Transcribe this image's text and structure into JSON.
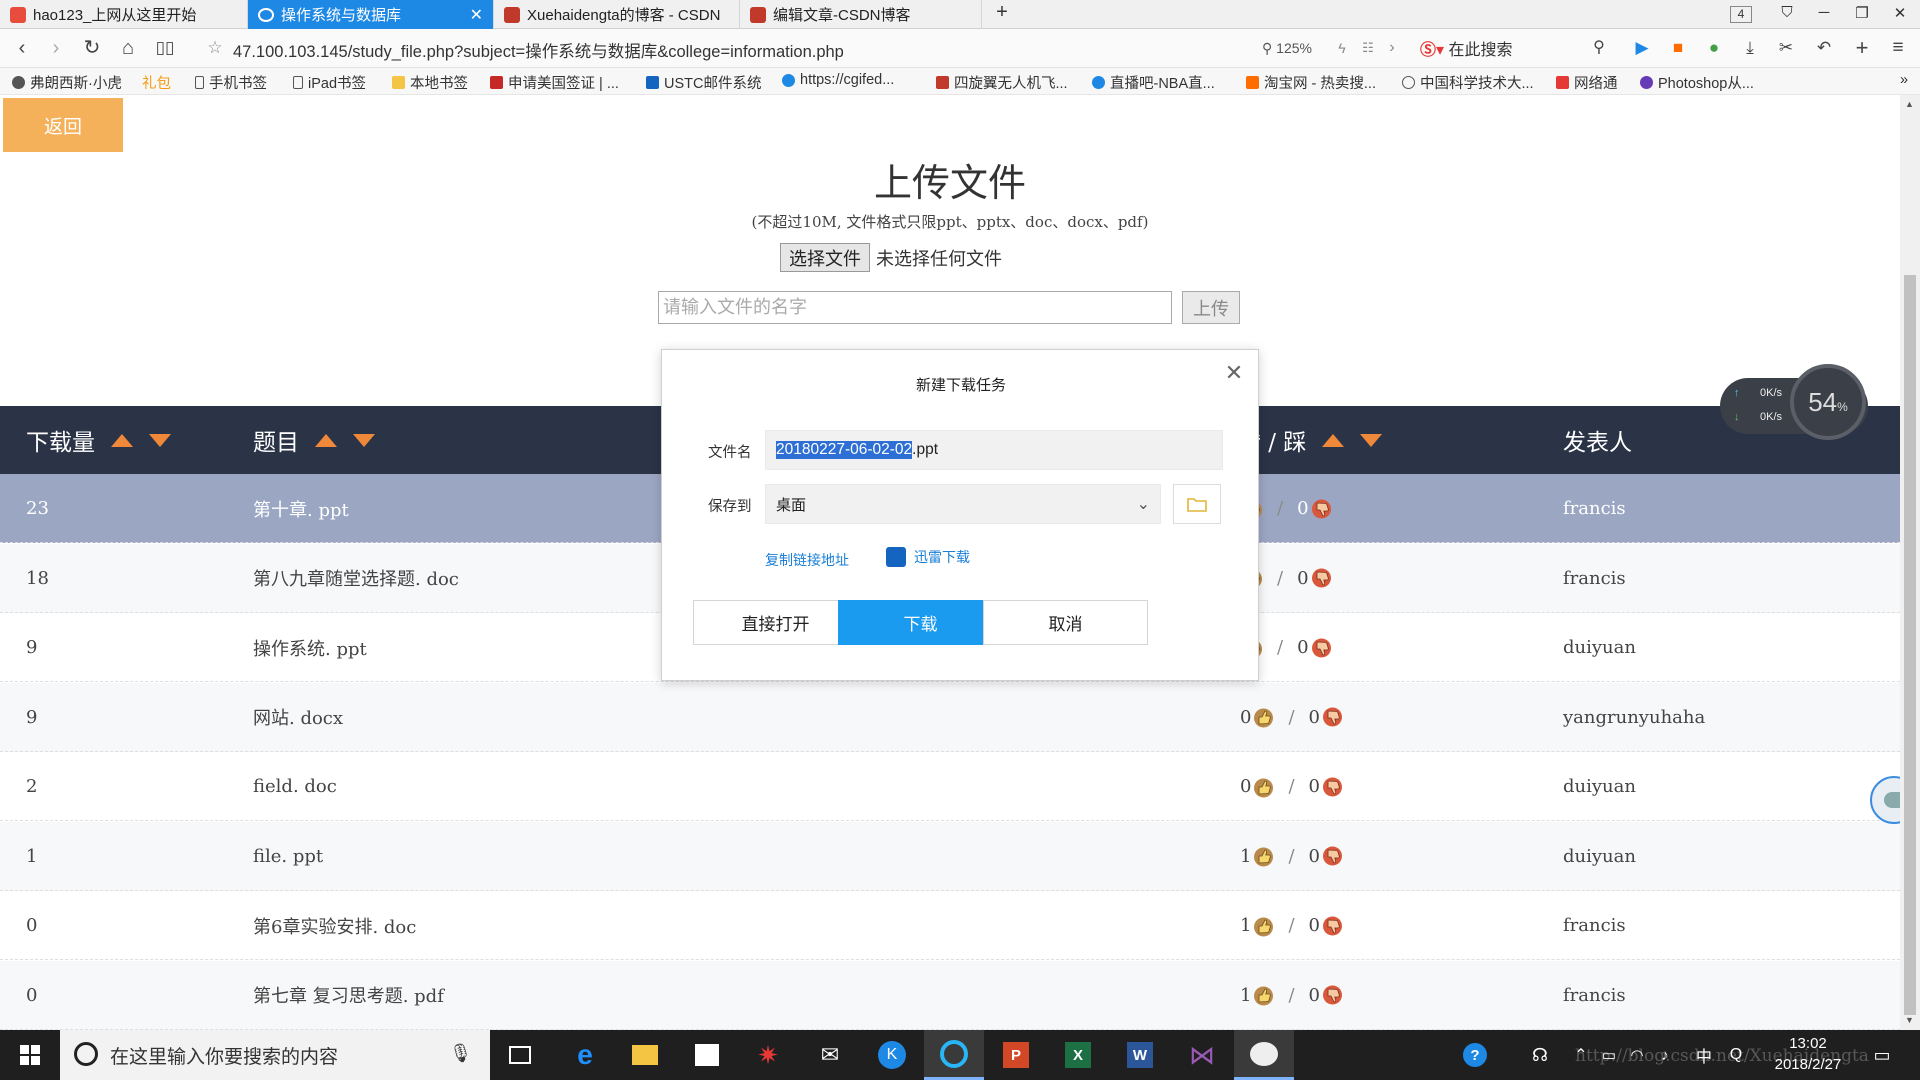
{
  "browser": {
    "tabs": [
      {
        "label": "hao123_上网从这里开始",
        "active": false,
        "icon_color": "#e74c3c"
      },
      {
        "label": "操作系统与数据库",
        "active": true,
        "icon_color": "#ffffff"
      },
      {
        "label": "Xuehaidengta的博客 - CSDN",
        "active": false,
        "icon_color": "#c0392b"
      },
      {
        "label": "编辑文章-CSDN博客",
        "active": false,
        "icon_color": "#c0392b"
      }
    ],
    "tab_counter": "4",
    "url": "47.100.103.145/study_file.php?subject=操作系统与数据库&college=information.php",
    "zoom": "125%",
    "search_placeholder": "在此搜索",
    "bookmarks": [
      "弗朗西斯·小虎",
      "礼包",
      "手机书签",
      "iPad书签",
      "本地书签",
      "申请美国签证 | ...",
      "USTC邮件系统",
      "https://cgifed...",
      "四旋翼无人机飞...",
      "直播吧-NBA直...",
      "淘宝网 - 热卖搜...",
      "中国科学技术大...",
      "网络通",
      "Photoshop从..."
    ]
  },
  "page": {
    "back_label": "返回",
    "upload_title": "上传文件",
    "upload_hint": "(不超过10M, 文件格式只限ppt、pptx、doc、docx、pdf)",
    "choose_file_label": "选择文件",
    "no_file_label": "未选择任何文件",
    "name_placeholder": "请输入文件的名字",
    "upload_button": "上传",
    "table": {
      "headers": {
        "downloads": "下载量",
        "title": "题目",
        "votes": "赞 / 踩",
        "author": "发表人"
      },
      "rows": [
        {
          "downloads": "23",
          "title": "第十章. ppt",
          "up": "",
          "down": "0",
          "author": "francis"
        },
        {
          "downloads": "18",
          "title": "第八九章随堂选择题. doc",
          "up": "",
          "down": "0",
          "author": "francis"
        },
        {
          "downloads": "9",
          "title": "操作系统. ppt",
          "up": "",
          "down": "0",
          "author": "duiyuan"
        },
        {
          "downloads": "9",
          "title": "网站. docx",
          "up": "0",
          "down": "0",
          "author": "yangrunyuhaha"
        },
        {
          "downloads": "2",
          "title": "field. doc",
          "up": "0",
          "down": "0",
          "author": "duiyuan"
        },
        {
          "downloads": "1",
          "title": "file. ppt",
          "up": "1",
          "down": "0",
          "author": "duiyuan"
        },
        {
          "downloads": "0",
          "title": "第6章实验安排. doc",
          "up": "1",
          "down": "0",
          "author": "francis"
        },
        {
          "downloads": "0",
          "title": "第七章 复习思考题. pdf",
          "up": "1",
          "down": "0",
          "author": "francis"
        }
      ],
      "vote_separator": "/"
    }
  },
  "dialog": {
    "title": "新建下载任务",
    "filename_label": "文件名",
    "filename_selected": "20180227-06-02-02",
    "filename_ext": ".ppt",
    "saveto_label": "保存到",
    "saveto_value": "桌面",
    "copy_link": "复制链接地址",
    "thunder": "迅雷下载",
    "btn_open": "直接打开",
    "btn_download": "下载",
    "btn_cancel": "取消"
  },
  "speed_widget": {
    "up": "0K/s",
    "down": "0K/s",
    "percent": "54",
    "percent_unit": "%"
  },
  "taskbar": {
    "search_placeholder": "在这里输入你要搜索的内容",
    "time": "13:02",
    "date": "2018/2/27",
    "ime": "中",
    "watermark": "http://blog.csdn.net/Xuehaidengta"
  },
  "colors": {
    "accent": "#1a9bf0",
    "table_head": "#2b3447",
    "selected_row": "#9ba6c3",
    "back_button": "#f5b05a",
    "sort_arrow": "#f0883a"
  }
}
